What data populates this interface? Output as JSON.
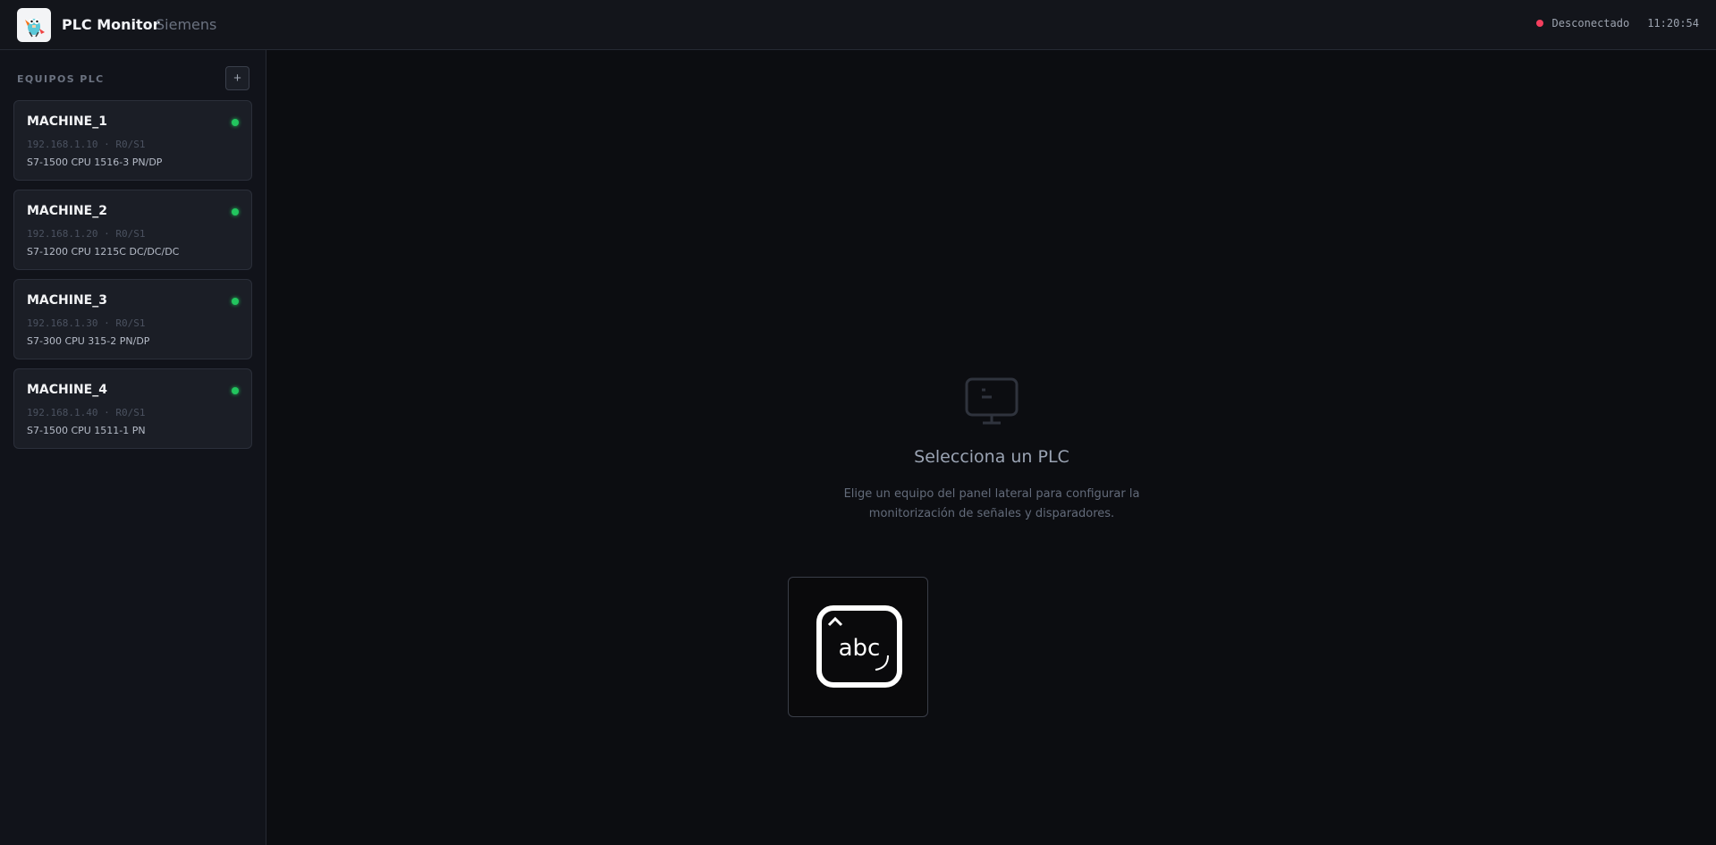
{
  "header": {
    "title": "PLC Monitor",
    "subtitle": "Siemens",
    "status_text": "Desconectado",
    "time": "11:20:54"
  },
  "sidebar": {
    "title": "EQUIPOS PLC",
    "add_label": "+",
    "items": [
      {
        "name": "MACHINE_1",
        "address": "192.168.1.10 · R0/S1",
        "model": "S7-1500 CPU 1516-3 PN/DP"
      },
      {
        "name": "MACHINE_2",
        "address": "192.168.1.20 · R0/S1",
        "model": "S7-1200 CPU 1215C DC/DC/DC"
      },
      {
        "name": "MACHINE_3",
        "address": "192.168.1.30 · R0/S1",
        "model": "S7-300 CPU 315-2 PN/DP"
      },
      {
        "name": "MACHINE_4",
        "address": "192.168.1.40 · R0/S1",
        "model": "S7-1500 CPU 1511-1 PN"
      }
    ]
  },
  "main": {
    "empty_title": "Selecciona un PLC",
    "empty_desc": "Elige un equipo del panel lateral para configurar la monitorización de señales y disparadores.",
    "ime_label": "abc"
  },
  "colors": {
    "online": "#22c55e",
    "offline": "#f43f5e",
    "background": "#0c0d11",
    "panel": "#1b1e26"
  },
  "icons": {
    "logo": "gopher-mascot-icon",
    "status": "status-dot-icon",
    "empty": "monitor-icon",
    "ime": "keyboard-ime-icon"
  }
}
